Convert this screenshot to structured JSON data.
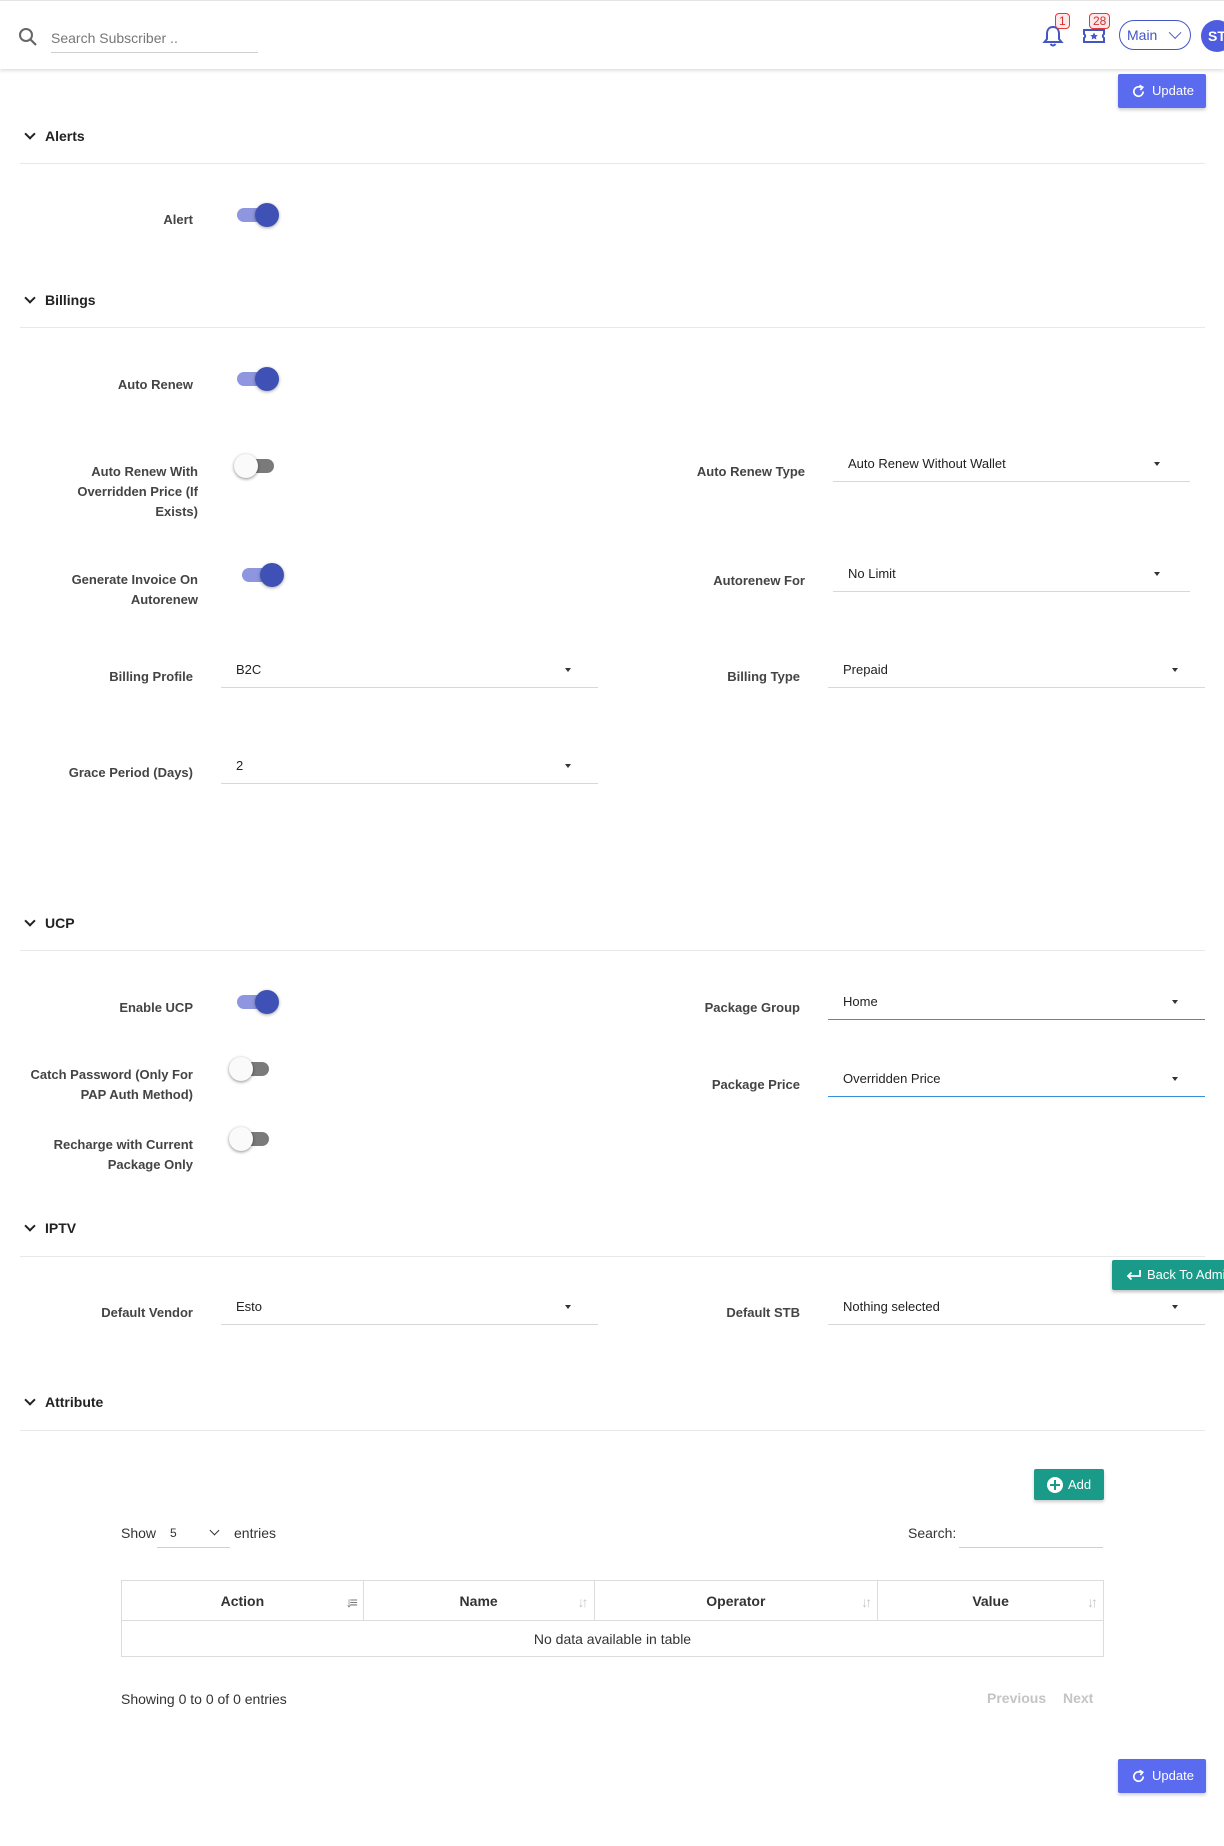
{
  "topbar": {
    "search_placeholder": "Search Subscriber ..",
    "notifications_count": "1",
    "tickets_count": "28",
    "main_select": "Main",
    "avatar_initials": "ST"
  },
  "buttons": {
    "update": "Update",
    "add": "Add",
    "back_to_admin": "Back To Admin"
  },
  "sections": {
    "alerts": {
      "title": "Alerts",
      "alert_label": "Alert",
      "alert_on": true
    },
    "billings": {
      "title": "Billings",
      "auto_renew_label": "Auto Renew",
      "auto_renew_overridden_label": "Auto Renew With Overridden Price (If Exists)",
      "generate_invoice_label": "Generate Invoice On Autorenew",
      "auto_renew_type_label": "Auto Renew Type",
      "auto_renew_type_value": "Auto Renew Without Wallet",
      "autorenew_for_label": "Autorenew For",
      "autorenew_for_value": "No Limit",
      "billing_profile_label": "Billing Profile",
      "billing_profile_value": "B2C",
      "billing_type_label": "Billing Type",
      "billing_type_value": "Prepaid",
      "grace_period_label": "Grace Period (Days)",
      "grace_period_value": "2"
    },
    "ucp": {
      "title": "UCP",
      "enable_ucp_label": "Enable UCP",
      "catch_password_label": "Catch Password (Only For PAP Auth Method)",
      "recharge_label": "Recharge with Current Package Only",
      "package_group_label": "Package Group",
      "package_group_value": "Home",
      "package_price_label": "Package Price",
      "package_price_value": "Overridden Price"
    },
    "iptv": {
      "title": "IPTV",
      "default_vendor_label": "Default Vendor",
      "default_vendor_value": "Esto",
      "default_stb_label": "Default STB",
      "default_stb_value": "Nothing selected"
    },
    "attribute": {
      "title": "Attribute"
    }
  },
  "table": {
    "show_label": "Show",
    "entries_value": "5",
    "entries_label": "entries",
    "search_label": "Search:",
    "columns": [
      "Action",
      "Name",
      "Operator",
      "Value"
    ],
    "empty_message": "No data available in table",
    "info": "Showing 0 to 0 of 0 entries",
    "previous": "Previous",
    "next": "Next"
  },
  "colors": {
    "primary": "#5b6bf0",
    "toggle_on": "#3f51b5",
    "teal": "#1a9b8a",
    "badge_red": "#e53935"
  }
}
